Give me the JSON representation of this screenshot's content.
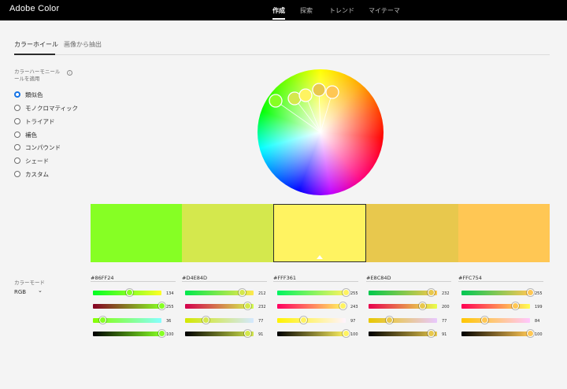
{
  "header": {
    "brand": "Adobe Color",
    "nav": [
      {
        "label": "作成",
        "active": true
      },
      {
        "label": "探索",
        "active": false
      },
      {
        "label": "トレンド",
        "active": false
      },
      {
        "label": "マイテーマ",
        "active": false
      }
    ]
  },
  "tabs": [
    {
      "label": "カラーホイール",
      "active": true
    },
    {
      "label": "画像から抽出",
      "active": false
    }
  ],
  "harmony": {
    "title": "カラーハーモニールールを適用",
    "info_icon": "info-icon",
    "options": [
      {
        "label": "類似色",
        "selected": true
      },
      {
        "label": "モノクロマティック",
        "selected": false
      },
      {
        "label": "トライアド",
        "selected": false
      },
      {
        "label": "補色",
        "selected": false
      },
      {
        "label": "コンパウンド",
        "selected": false
      },
      {
        "label": "シェード",
        "selected": false
      },
      {
        "label": "カスタム",
        "selected": false
      }
    ]
  },
  "color_mode": {
    "label": "カラーモード",
    "value": "RGB"
  },
  "swatches": [
    {
      "hex": "#86FF24",
      "color": "#86ff24",
      "selected": false,
      "values": [
        "134",
        "255",
        "36",
        "100"
      ]
    },
    {
      "hex": "#D4E84D",
      "color": "#d4e84d",
      "selected": false,
      "values": [
        "212",
        "232",
        "77",
        "91"
      ]
    },
    {
      "hex": "#FFF361",
      "color": "#fff361",
      "selected": true,
      "values": [
        "255",
        "243",
        "97",
        "100"
      ]
    },
    {
      "hex": "#E8C84D",
      "color": "#e8c84d",
      "selected": false,
      "values": [
        "232",
        "200",
        "77",
        "91"
      ]
    },
    {
      "hex": "#FFC754",
      "color": "#ffc754",
      "selected": false,
      "values": [
        "255",
        "199",
        "84",
        "100"
      ]
    }
  ]
}
